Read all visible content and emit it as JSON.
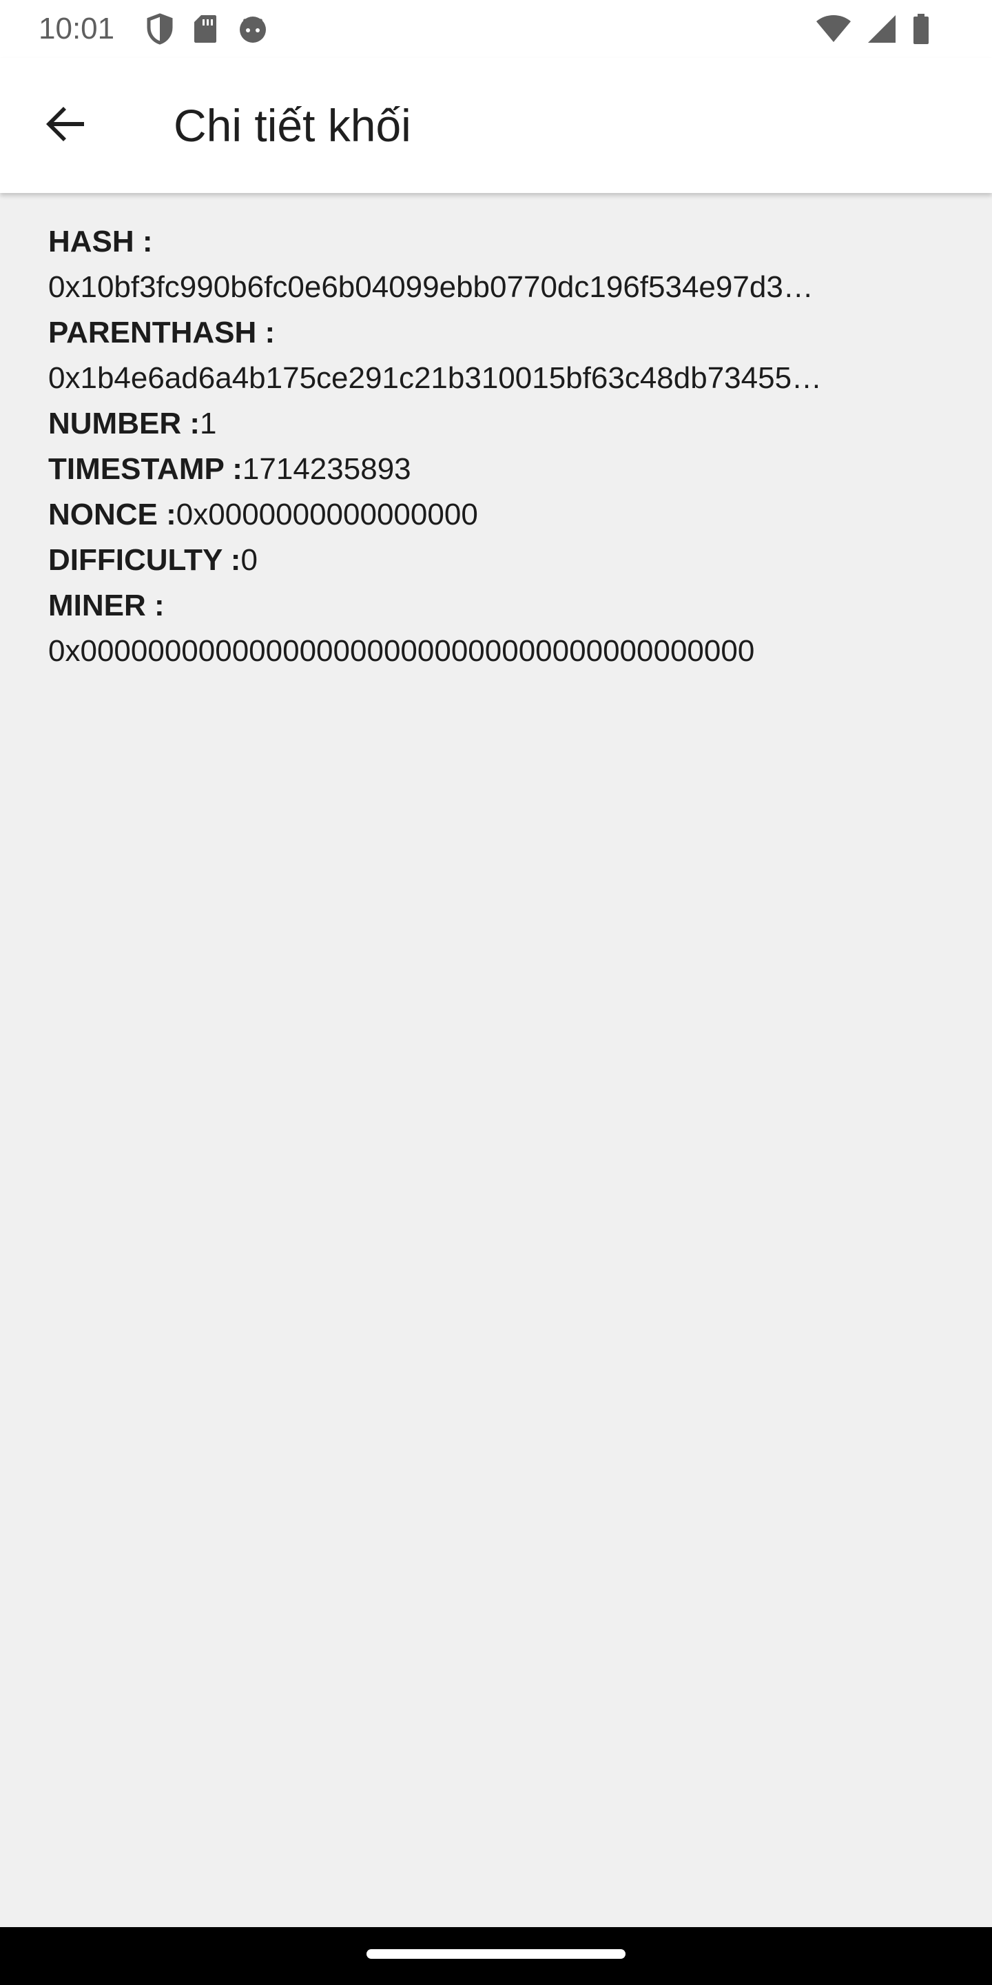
{
  "status_bar": {
    "time": "10:01",
    "left_icons": [
      "shield-icon",
      "sd-card-icon",
      "android-face-icon"
    ],
    "right_icons": [
      "wifi-icon",
      "cellular-signal-icon",
      "battery-icon"
    ]
  },
  "app_bar": {
    "back_icon": "arrow-back-icon",
    "title": "Chi tiết khối"
  },
  "block": {
    "hash_label": "HASH :",
    "hash_value": "0x10bf3fc990b6fc0e6b04099ebb0770dc196f534e97d3…",
    "parenthash_label": "PARENTHASH :",
    "parenthash_value": "0x1b4e6ad6a4b175ce291c21b310015bf63c48db73455…",
    "number_label": "NUMBER :",
    "number_value": "1",
    "timestamp_label": "TIMESTAMP :",
    "timestamp_value": "1714235893",
    "nonce_label": "NONCE :",
    "nonce_value": "0x0000000000000000",
    "difficulty_label": "DIFFICULTY :",
    "difficulty_value": "0",
    "miner_label": "MINER :",
    "miner_value": "0x0000000000000000000000000000000000000000"
  },
  "colors": {
    "background": "#f0f0f0",
    "app_bar": "#ffffff",
    "text": "#1c1c1c",
    "nav_bar": "#000000"
  }
}
